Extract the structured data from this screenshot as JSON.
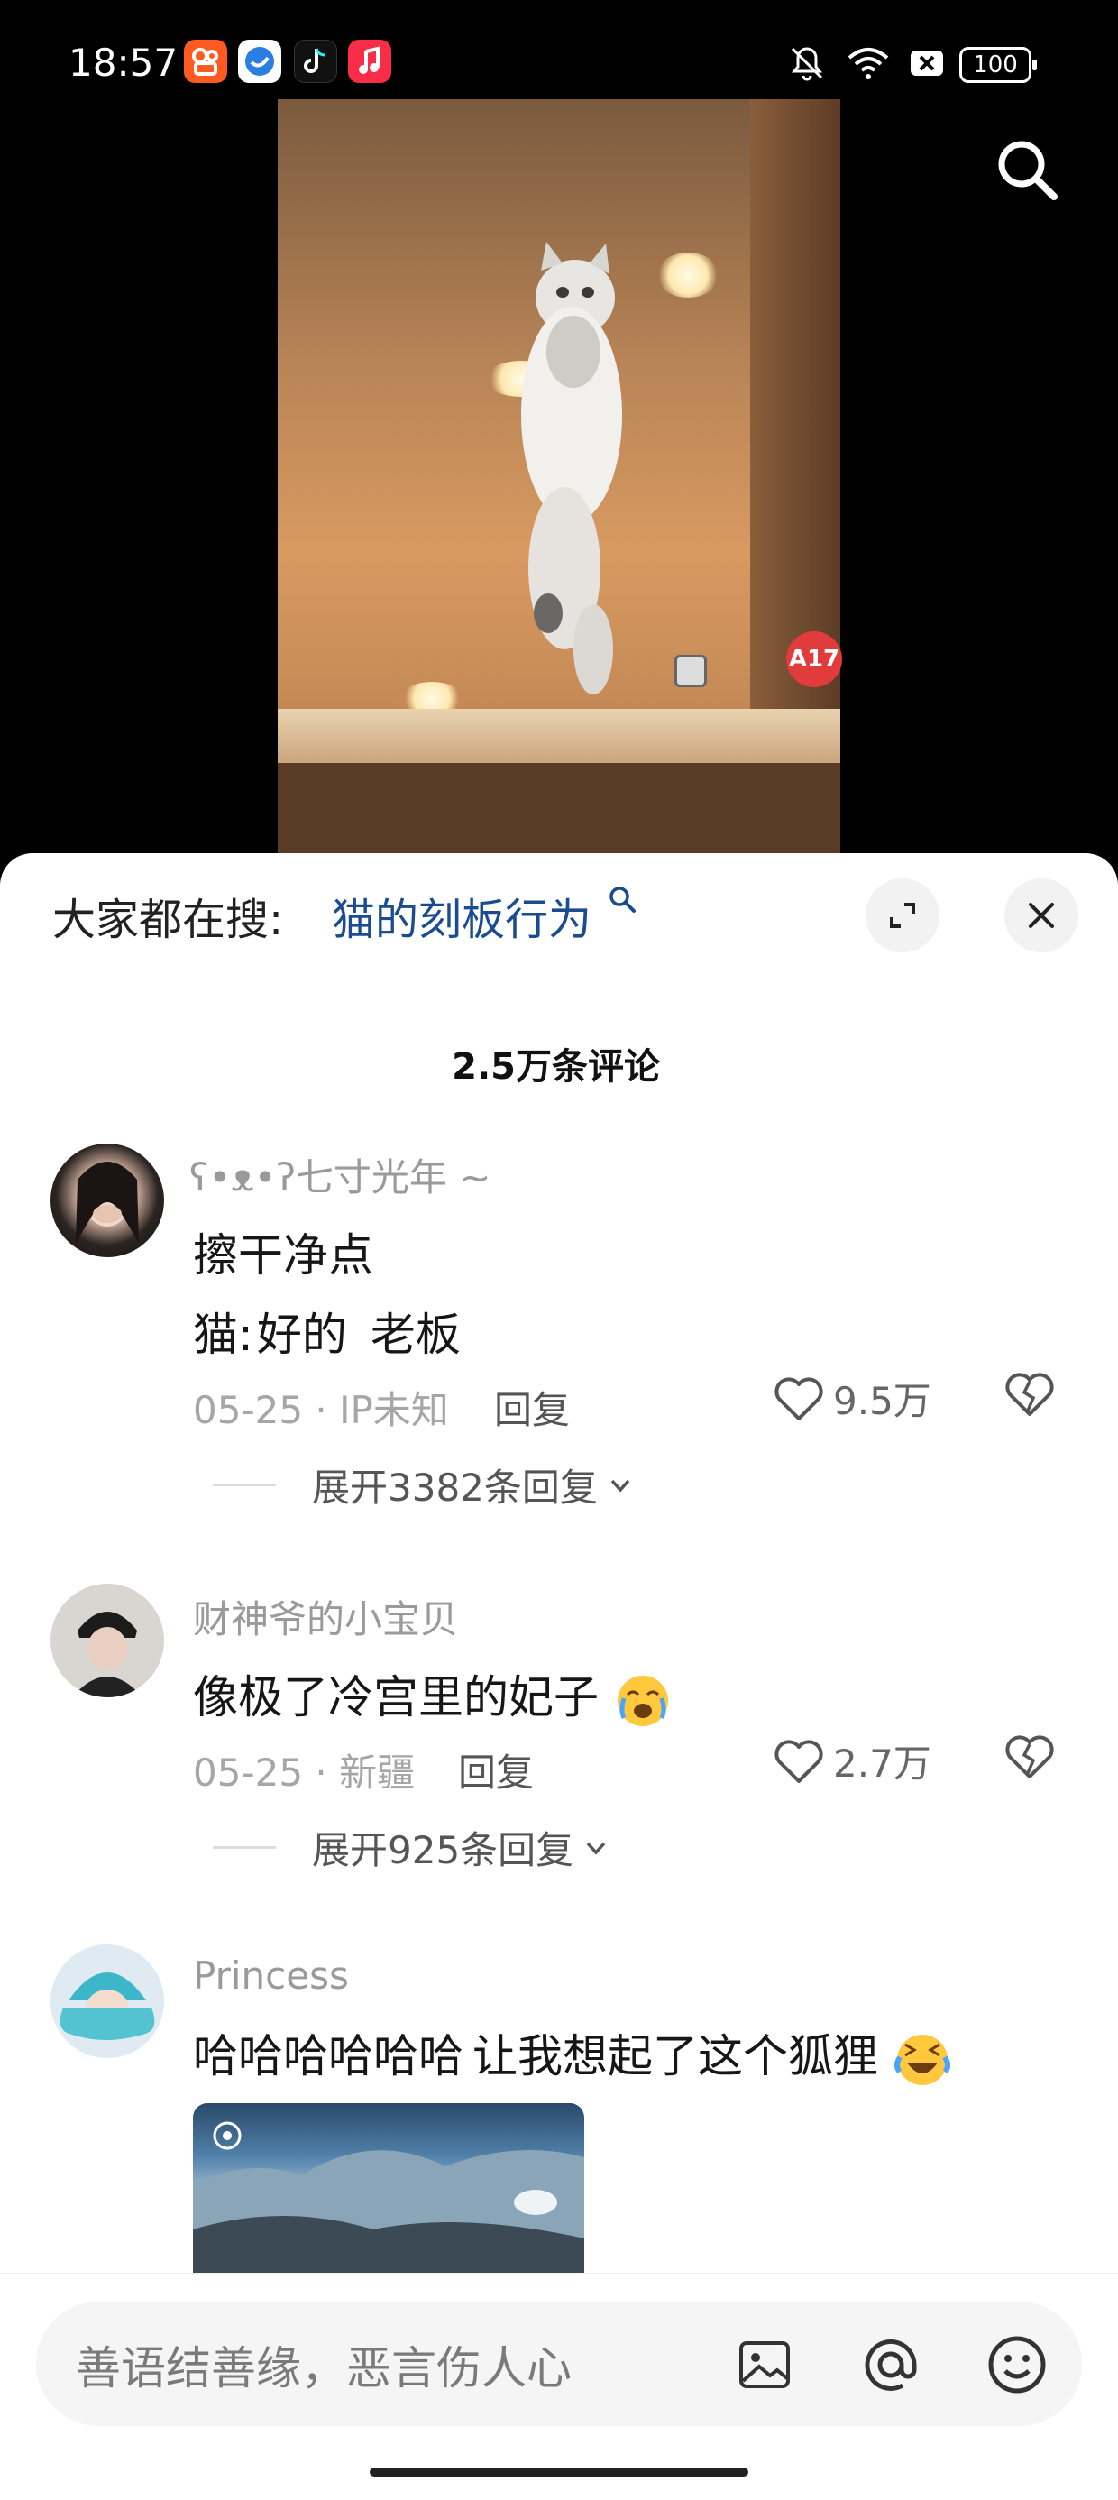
{
  "status_bar": {
    "time": "18:57",
    "battery": "100",
    "apps": [
      "kuaishou-app-icon",
      "bird-app-icon",
      "tiktok-app-icon",
      "music-app-icon"
    ]
  },
  "video": {
    "badge": "A17"
  },
  "sheet": {
    "trending_label": "大家都在搜:",
    "trending_query": "猫的刻板行为",
    "comment_count": "2.5万条评论"
  },
  "comments": [
    {
      "username": "ʕ•ᴥ•ʔ七寸光年 ~",
      "line1": "擦干净点",
      "line2_prefix": "猫:",
      "line2_highlight": "好的",
      "line2_suffix": "老板",
      "date": "05-25 · IP未知",
      "reply": "回复",
      "likes": "9.5万",
      "expand": "展开3382条回复"
    },
    {
      "username": "财神爷的小宝贝",
      "text": "像极了冷宫里的妃子",
      "date": "05-25 · 新疆",
      "reply": "回复",
      "likes": "2.7万",
      "expand": "展开925条回复"
    },
    {
      "username": "Princess",
      "text_a": "哈哈哈哈哈哈",
      "text_b": "让我想起了",
      "text_c": "这",
      "text_d": "个狐狸"
    }
  ],
  "input": {
    "placeholder": "善语结善缘，恶言伤人心"
  },
  "colors": {
    "accent_link": "#1a4c8f",
    "muted": "#9a9a9a"
  }
}
